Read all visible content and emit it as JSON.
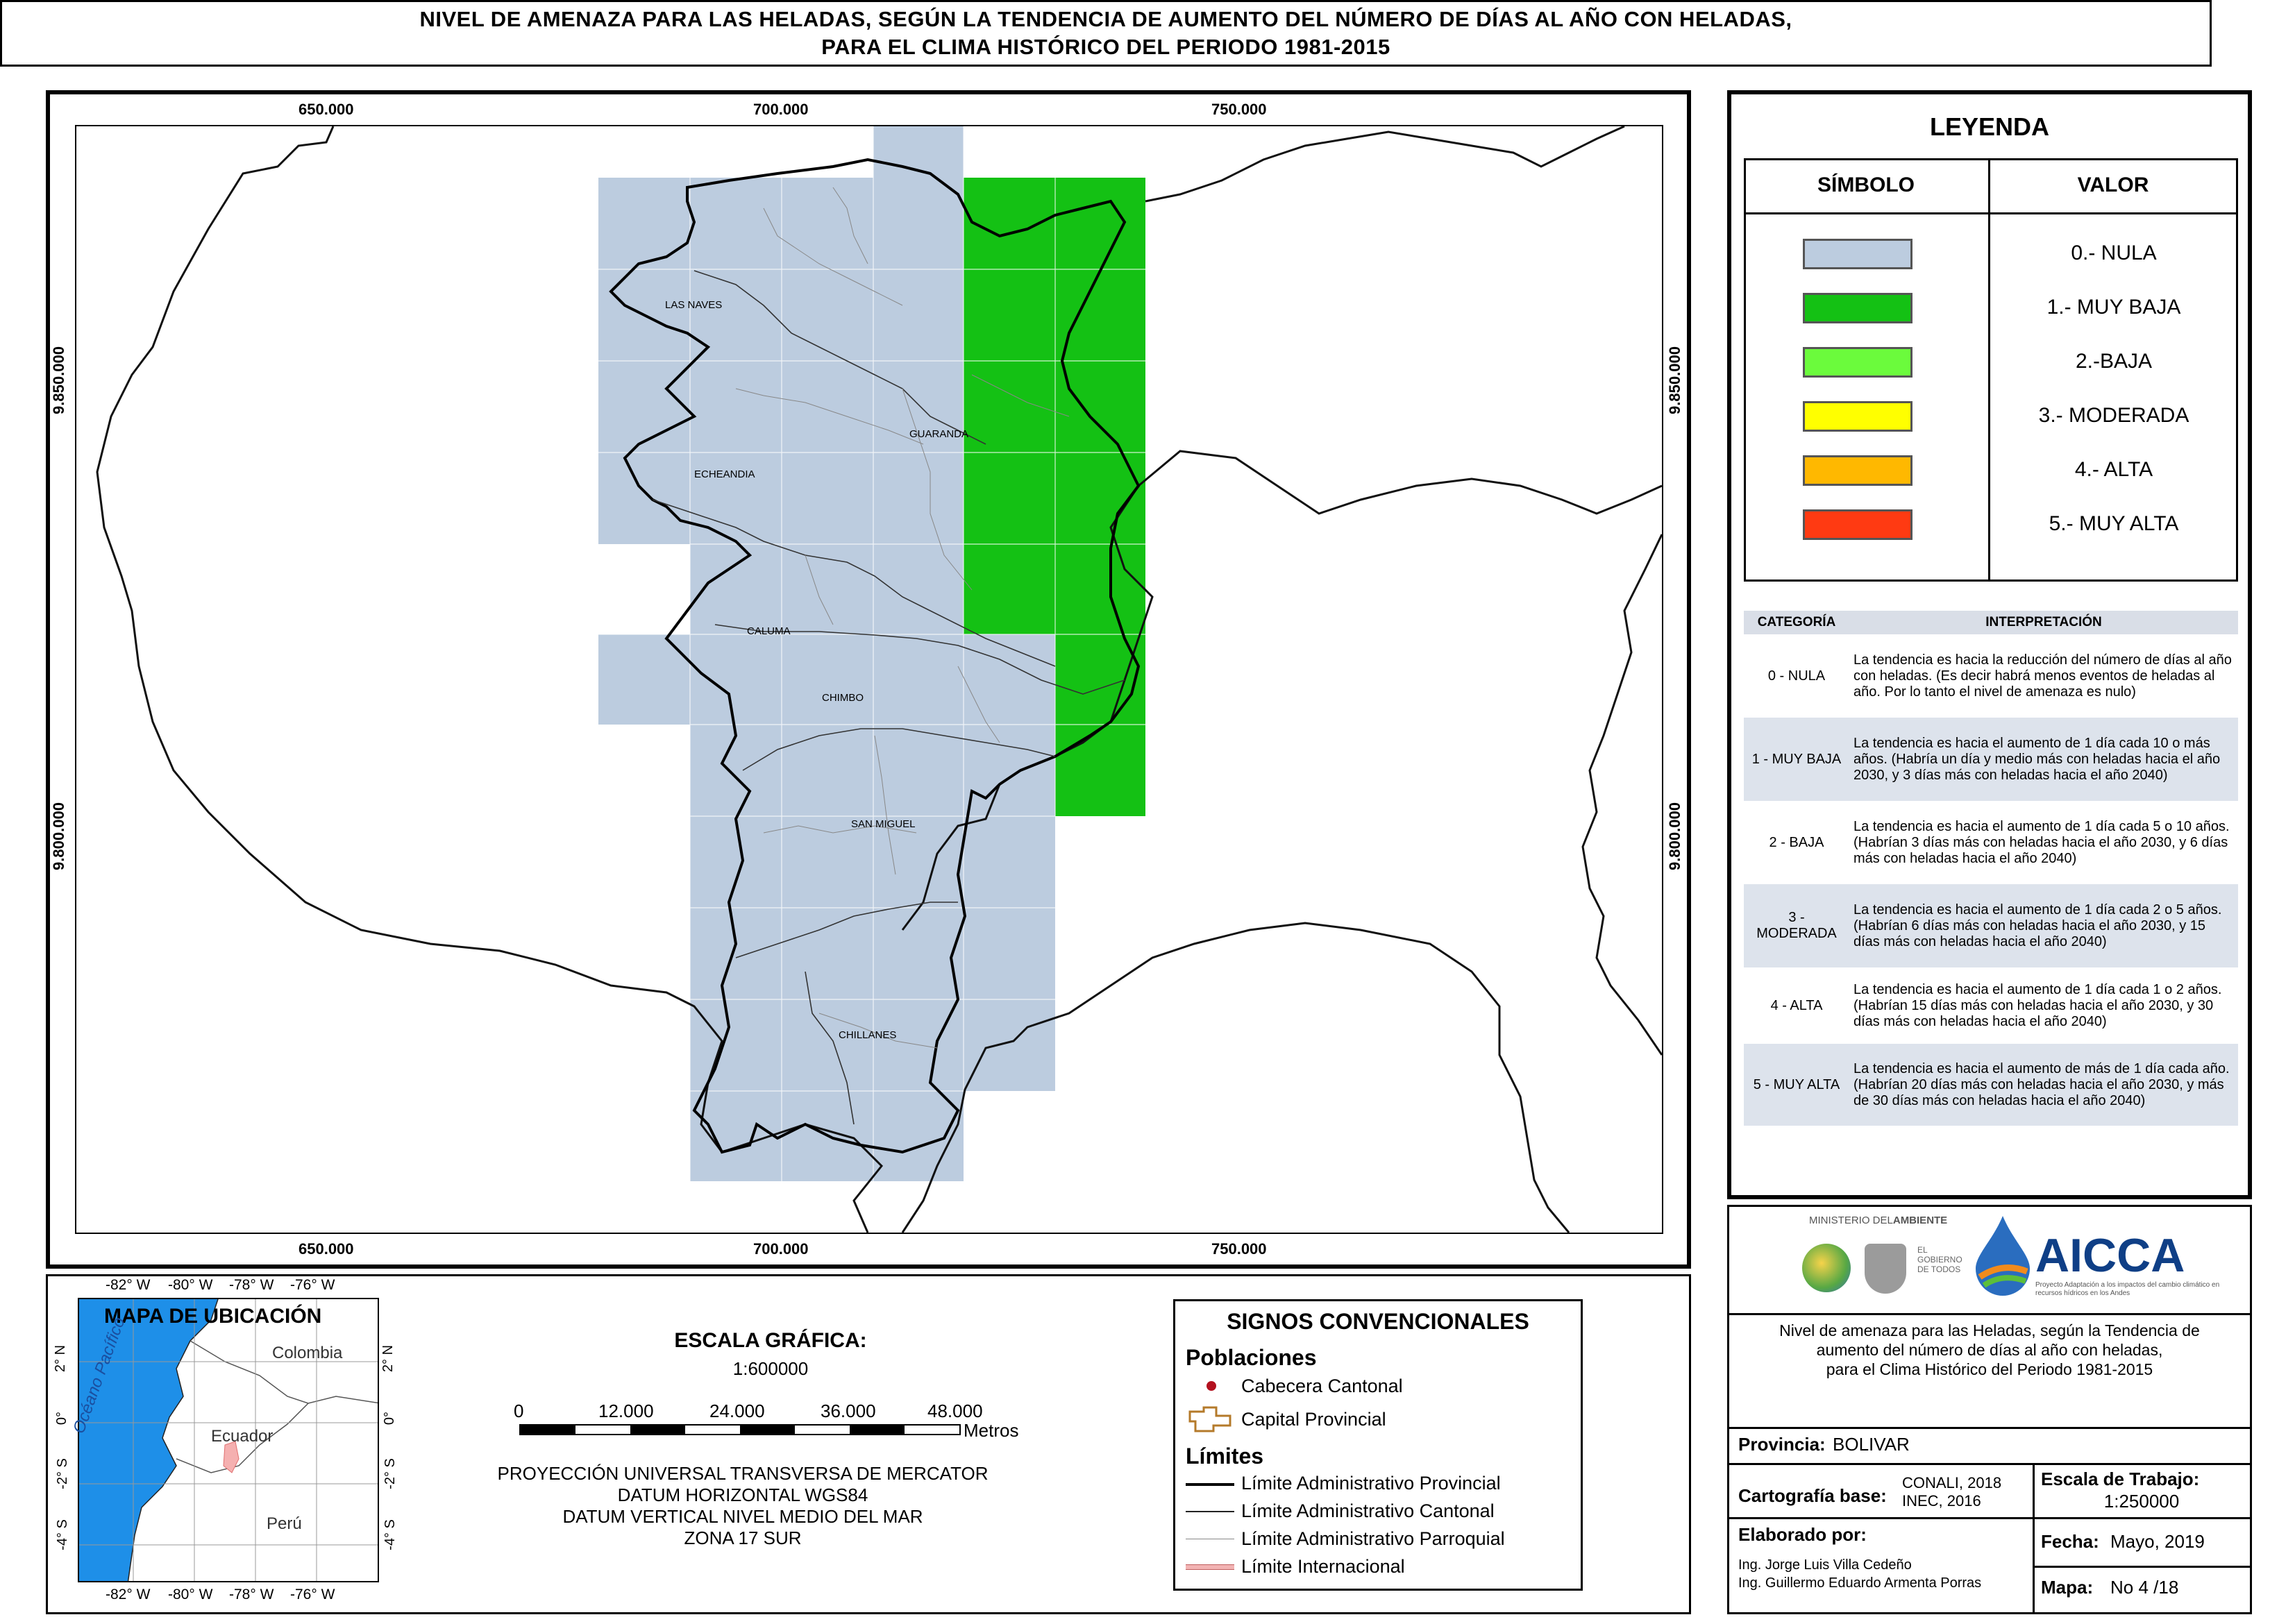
{
  "title": {
    "line1": "NIVEL DE AMENAZA PARA LAS HELADAS, SEGÚN LA TENDENCIA DE AUMENTO DEL NÚMERO DE DÍAS AL AÑO CON HELADAS,",
    "line2": "PARA EL CLIMA HISTÓRICO DEL PERIODO 1981-2015"
  },
  "map": {
    "x_ticks": [
      "650.000",
      "700.000",
      "750.000"
    ],
    "y_ticks": [
      "9.850.000",
      "9.800.000"
    ],
    "places": [
      "LAS NAVES",
      "GUARANDA",
      "ECHEANDIA",
      "CALUMA",
      "CHIMBO",
      "SAN MIGUEL",
      "CHILLANES"
    ],
    "colors": {
      "nula": "#bcccdf",
      "muy_baja": "#14c114",
      "baja": "#6bfb3c",
      "moderada": "#ffff00",
      "alta": "#ffb800",
      "muy_alta": "#ff3a12"
    }
  },
  "legend": {
    "title": "LEYENDA",
    "col_symbol": "SÍMBOLO",
    "col_value": "VALOR",
    "items": [
      {
        "label": "0.- NULA",
        "color": "#bcccdf"
      },
      {
        "label": "1.- MUY BAJA",
        "color": "#14c114"
      },
      {
        "label": "2.-BAJA",
        "color": "#6bfb3c"
      },
      {
        "label": "3.- MODERADA",
        "color": "#ffff00"
      },
      {
        "label": "4.- ALTA",
        "color": "#ffb800"
      },
      {
        "label": "5.- MUY ALTA",
        "color": "#ff3a12"
      }
    ]
  },
  "interpretation": {
    "col_category": "CATEGORÍA",
    "col_interp": "INTERPRETACIÓN",
    "rows": [
      {
        "category": "0 - NULA",
        "text": "La tendencia es hacia la reducción del número de días al año con heladas. (Es decir habrá menos eventos de heladas al año. Por lo tanto el nivel de amenaza es nulo)"
      },
      {
        "category": "1 - MUY BAJA",
        "text": "La tendencia es hacia el aumento de 1 día cada 10 o más años. (Habría un día y medio más con heladas hacia el año 2030, y 3 días más con heladas hacia el año 2040)"
      },
      {
        "category": "2 - BAJA",
        "text": "La tendencia es hacia el aumento de 1 día cada 5 o 10 años. (Habrían 3 días más con heladas hacia el año 2030, y 6 días más con heladas hacia el año 2040)"
      },
      {
        "category": "3 - MODERADA",
        "text": "La tendencia es hacia el aumento de 1 día cada 2 o 5 años. (Habrían 6 días más con heladas hacia el año 2030, y 15 días más con heladas hacia el año 2040)"
      },
      {
        "category": "4 - ALTA",
        "text": "La tendencia es hacia el aumento de 1 día cada 1 o 2 años. (Habrían 15 días más con heladas hacia el año 2030, y 30 días más con heladas hacia el año 2040)"
      },
      {
        "category": "5 - MUY ALTA",
        "text": "La tendencia es hacia el aumento de más de 1 día cada año. (Habrían 20 días más con heladas hacia el año 2030, y más de 30 días más con heladas hacia el año 2040)"
      }
    ]
  },
  "location_map": {
    "title": "MAPA DE UBICACIÓN",
    "lon_ticks": [
      "-82° W",
      "-80° W",
      "-78° W",
      "-76° W"
    ],
    "lat_ticks": [
      "2° N",
      "0°",
      "-2° S",
      "-4° S"
    ],
    "countries": [
      "Colombia",
      "Ecuador",
      "Perú"
    ],
    "ocean": "Océano Pacífico"
  },
  "scale": {
    "title": "ESCALA GRÁFICA:",
    "ratio": "1:600000",
    "ticks": [
      "0",
      "12.000",
      "24.000",
      "36.000",
      "48.000"
    ],
    "unit": "Metros",
    "projection": [
      "PROYECCIÓN UNIVERSAL TRANSVERSA DE MERCATOR",
      "DATUM HORIZONTAL WGS84",
      "DATUM VERTICAL NIVEL MEDIO DEL MAR",
      "ZONA 17 SUR"
    ]
  },
  "signs": {
    "title": "SIGNOS CONVENCIONALES",
    "poblaciones": "Poblaciones",
    "cabecera": "Cabecera Cantonal",
    "capital": "Capital Provincial",
    "limites": "Límites",
    "lim_provincial": "Límite Administrativo Provincial",
    "lim_cantonal": "Límite Administrativo Cantonal",
    "lim_parroquial": "Límite Administrativo Parroquial",
    "lim_internacional": "Límite Internacional"
  },
  "logos": {
    "ministerio_a": "MINISTERIO DEL",
    "ministerio_b": "AMBIENTE",
    "gobierno": "EL GOBIERNO DE TODOS",
    "aicca": "AICCA",
    "aicca_sub": "Proyecto Adaptación a los impactos del cambio climático en recursos hídricos en los Andes"
  },
  "info": {
    "description": [
      "Nivel de amenaza para las Heladas, según la Tendencia de",
      "aumento del número de días al año con heladas,",
      "para el Clima Histórico del Periodo 1981-2015"
    ],
    "provincia_label": "Provincia:",
    "provincia": "BOLIVAR",
    "cartografia_label": "Cartografía base:",
    "cartografia": [
      "CONALI, 2018",
      "INEC, 2016"
    ],
    "escala_label": "Escala de Trabajo:",
    "escala": "1:250000",
    "elaborado_label": "Elaborado por:",
    "autores": [
      "Ing. Jorge Luis Villa Cedeño",
      "Ing. Guillermo Eduardo Armenta Porras"
    ],
    "fecha_label": "Fecha:",
    "fecha": "Mayo, 2019",
    "mapa_label": "Mapa:",
    "mapa": "No 4 /18"
  }
}
